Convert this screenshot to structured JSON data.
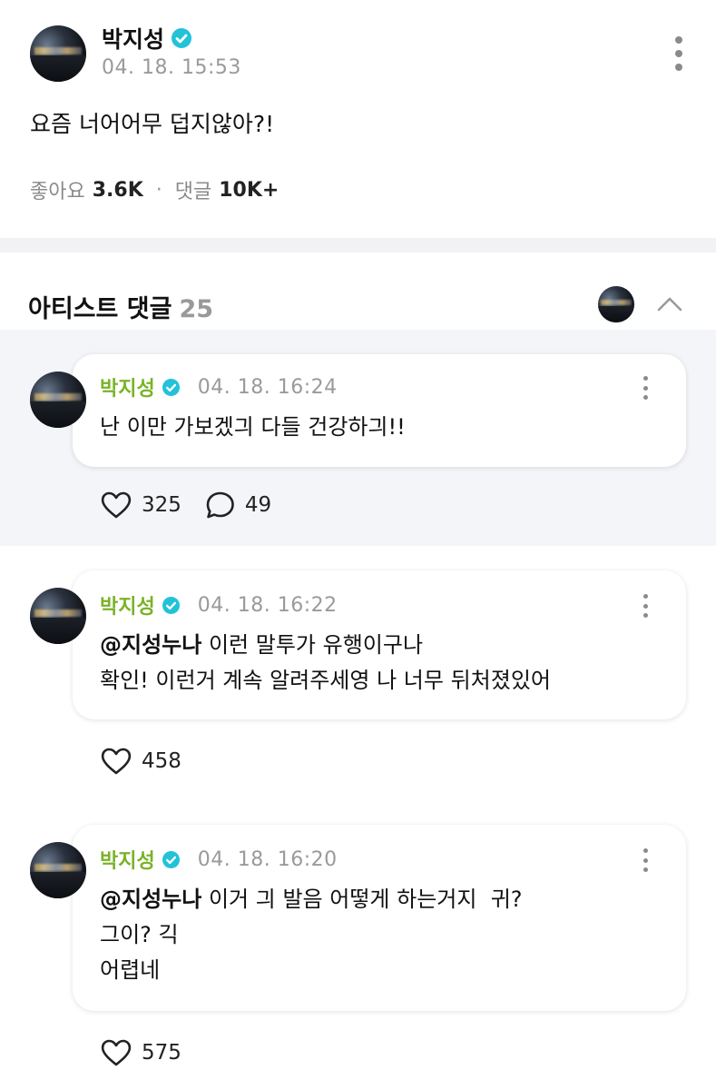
{
  "post": {
    "author": "박지성",
    "date": "04. 18. 15:53",
    "body": "요즘 너어어무 덥지않아?!",
    "likes_label": "좋아요",
    "likes_count": "3.6K",
    "comments_label": "댓글",
    "comments_count": "10K+"
  },
  "artist_comments": {
    "title": "아티스트 댓글",
    "count": "25"
  },
  "comments": [
    {
      "author": "박지성",
      "date": "04. 18. 16:24",
      "mention": "",
      "lines": [
        "난 이만 가보겠긔 다들 건강하긔!!"
      ],
      "likes": "325",
      "replies": "49"
    },
    {
      "author": "박지성",
      "date": "04. 18. 16:22",
      "mention": "@지성누나",
      "lines": [
        "이런 말투가 유행이구나",
        "확인! 이런거 계속 알려주세영 나 너무 뒤처졌있어"
      ],
      "likes": "458"
    },
    {
      "author": "박지성",
      "date": "04. 18. 16:20",
      "mention": "@지성누나",
      "lines": [
        "이거 긔 발음 어떻게 하는거지  귀?",
        "그이? 긱",
        "어렵네"
      ],
      "likes": "575"
    }
  ],
  "colors": {
    "author_green": "#7ab327",
    "verified_cyan": "#22c2d8",
    "highlight_bg": "#f4f5f9",
    "muted_gray": "#9a9a9a"
  },
  "icons": [
    "verified-badge-icon",
    "kebab-menu-icon",
    "chevron-up-icon",
    "heart-icon",
    "comment-bubble-icon"
  ]
}
